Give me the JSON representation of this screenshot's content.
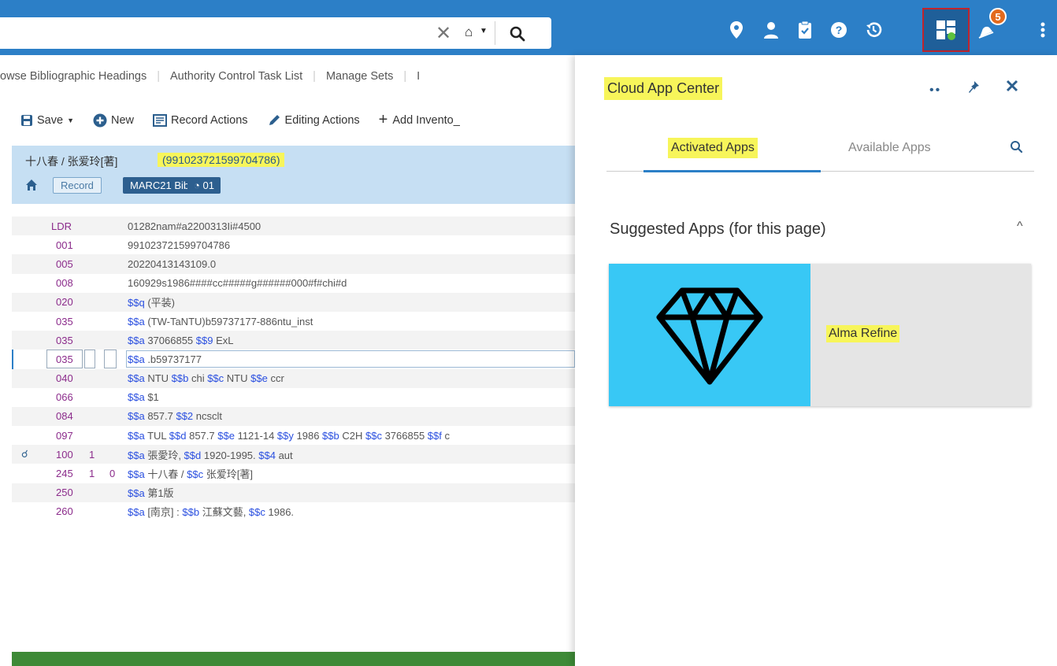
{
  "topbar": {
    "search_clear": "✕",
    "notifications_count": "5"
  },
  "nav_tabs": [
    "owse Bibliographic Headings",
    "Authority Control Task List",
    "Manage Sets",
    "I"
  ],
  "toolbar": {
    "save": "Save",
    "new": "New",
    "record_actions": "Record Actions",
    "editing_actions": "Editing Actions",
    "add_inventory": "Add Invento_"
  },
  "record": {
    "title": "十八春 / 张爱玲[著]",
    "id": "(991023721599704786)",
    "badge_record": "Record",
    "badge_format": "MARC21 Bib",
    "badge_count": "01"
  },
  "marc_rows": [
    {
      "tag": "LDR",
      "ind1": "",
      "ind2": "",
      "value": "01282nam#a2200313Ii#4500"
    },
    {
      "tag": "001",
      "ind1": "",
      "ind2": "",
      "value": "991023721599704786"
    },
    {
      "tag": "005",
      "ind1": "",
      "ind2": "",
      "value": "20220413143109.0"
    },
    {
      "tag": "008",
      "ind1": "",
      "ind2": "",
      "value": "160929s1986####cc#####g######000#f#chi#d"
    },
    {
      "tag": "020",
      "ind1": "",
      "ind2": "",
      "value": "$$q (平装)"
    },
    {
      "tag": "035",
      "ind1": "",
      "ind2": "",
      "value": "$$a (TW-TaNTU)b59737177-886ntu_inst"
    },
    {
      "tag": "035",
      "ind1": "",
      "ind2": "",
      "value": "$$a 37066855 $$9 ExL"
    },
    {
      "tag": "035",
      "ind1": "",
      "ind2": "",
      "value": "$$a .b59737177"
    },
    {
      "tag": "040",
      "ind1": "",
      "ind2": "",
      "value": "$$a NTU $$b chi $$c NTU $$e ccr"
    },
    {
      "tag": "066",
      "ind1": "",
      "ind2": "",
      "value": "$$a $1"
    },
    {
      "tag": "084",
      "ind1": "",
      "ind2": "",
      "value": "$$a 857.7 $$2 ncsclt"
    },
    {
      "tag": "097",
      "ind1": "",
      "ind2": "",
      "value": "$$a TUL $$d 857.7 $$e 1121-14 $$y 1986 $$b C2H $$c 3766855 $$f c"
    },
    {
      "tag": "100",
      "ind1": "1",
      "ind2": "",
      "value": "$$a 張愛玲, $$d 1920-1995. $$4 aut"
    },
    {
      "tag": "245",
      "ind1": "1",
      "ind2": "0",
      "value": "$$a 十八春 / $$c 张爱玲[著]"
    },
    {
      "tag": "250",
      "ind1": "",
      "ind2": "",
      "value": "$$a 第1版"
    },
    {
      "tag": "260",
      "ind1": "",
      "ind2": "",
      "value": "$$a [南京] : $$b 江蘇文藝, $$c 1986."
    }
  ],
  "cloud_app_center": {
    "title": "Cloud App Center",
    "more": "••",
    "tab_activated": "Activated Apps",
    "tab_available": "Available Apps",
    "section_title": "Suggested Apps (for this page)",
    "collapse_caret": "^",
    "app_name": "Alma Refine"
  },
  "colors": {
    "topbar": "#2c7fc7",
    "highlight": "#f7f55a",
    "card_image_bg": "#38c8f5",
    "marc_tag": "#8b2b8b",
    "subfield": "#2a4fe0"
  }
}
